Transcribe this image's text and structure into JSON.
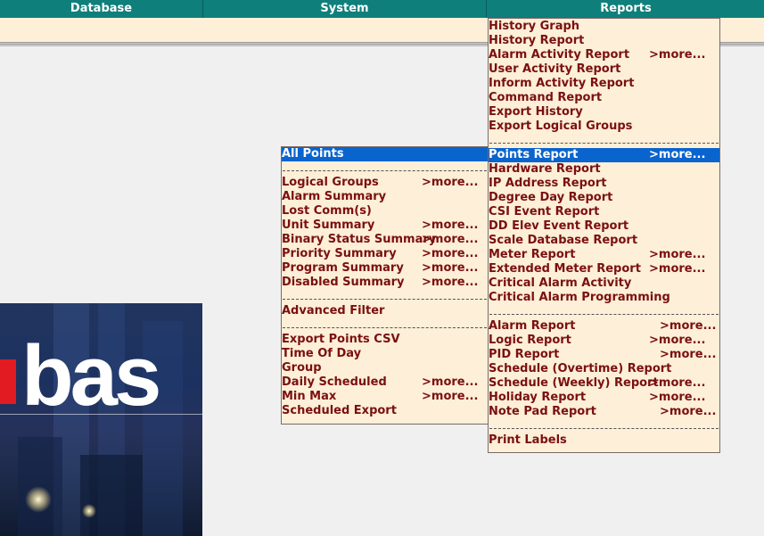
{
  "menubar": {
    "database": "Database",
    "system": "System",
    "reports": "Reports"
  },
  "logo": {
    "text": "bas",
    "accent_color": "#e21b22"
  },
  "system_menu": {
    "items": [
      {
        "label": "All Points",
        "more": "",
        "selected": true
      },
      {
        "label": "Logical Groups",
        "more": ">more..."
      },
      {
        "label": "Alarm Summary",
        "more": ""
      },
      {
        "label": "Lost Comm(s)",
        "more": ""
      },
      {
        "label": "Unit Summary",
        "more": ">more..."
      },
      {
        "label": "Binary Status Summary",
        "more": ">more..."
      },
      {
        "label": "Priority Summary",
        "more": ">more..."
      },
      {
        "label": "Program Summary",
        "more": ">more..."
      },
      {
        "label": "Disabled Summary",
        "more": ">more..."
      },
      {
        "label": "Advanced Filter",
        "more": ""
      },
      {
        "label": "Export Points CSV",
        "more": ""
      },
      {
        "label": "Time Of Day",
        "more": ""
      },
      {
        "label": "Group",
        "more": ""
      },
      {
        "label": "Daily Scheduled",
        "more": ">more..."
      },
      {
        "label": "Min Max",
        "more": ">more..."
      },
      {
        "label": "Scheduled Export",
        "more": ""
      }
    ]
  },
  "reports_menu": {
    "items": [
      {
        "label": "History Graph",
        "more": ""
      },
      {
        "label": "History Report",
        "more": ""
      },
      {
        "label": "Alarm Activity Report",
        "more": ">more..."
      },
      {
        "label": "User Activity Report",
        "more": ""
      },
      {
        "label": "Inform Activity Report",
        "more": ""
      },
      {
        "label": "Command Report",
        "more": ""
      },
      {
        "label": "Export History",
        "more": ""
      },
      {
        "label": "Export Logical Groups",
        "more": ""
      },
      {
        "label": "Points Report",
        "more": ">more...",
        "selected": true
      },
      {
        "label": "Hardware Report",
        "more": ""
      },
      {
        "label": "IP Address Report",
        "more": ""
      },
      {
        "label": "Degree Day Report",
        "more": ""
      },
      {
        "label": "CSI Event Report",
        "more": ""
      },
      {
        "label": "DD Elev Event Report",
        "more": ""
      },
      {
        "label": "Scale Database Report",
        "more": ""
      },
      {
        "label": "Meter Report",
        "more": ">more..."
      },
      {
        "label": "Extended Meter Report",
        "more": ">more..."
      },
      {
        "label": "Critical Alarm Activity",
        "more": ""
      },
      {
        "label": "Critical Alarm Programming",
        "more": ""
      },
      {
        "label": "Alarm Report",
        "more": ">more..."
      },
      {
        "label": "Logic Report",
        "more": ">more..."
      },
      {
        "label": "PID Report",
        "more": ">more..."
      },
      {
        "label": "Schedule (Overtime) Report",
        "more": ""
      },
      {
        "label": "Schedule (Weekly) Report",
        "more": ">more..."
      },
      {
        "label": "Holiday Report",
        "more": ">more..."
      },
      {
        "label": "Note Pad Report",
        "more": ">more..."
      },
      {
        "label": "Print Labels",
        "more": ""
      }
    ]
  },
  "colors": {
    "menubar": "#0f7f7b",
    "menu_bg": "#fdefd8",
    "menu_text": "#7a1010",
    "selection": "#0a64cd"
  }
}
